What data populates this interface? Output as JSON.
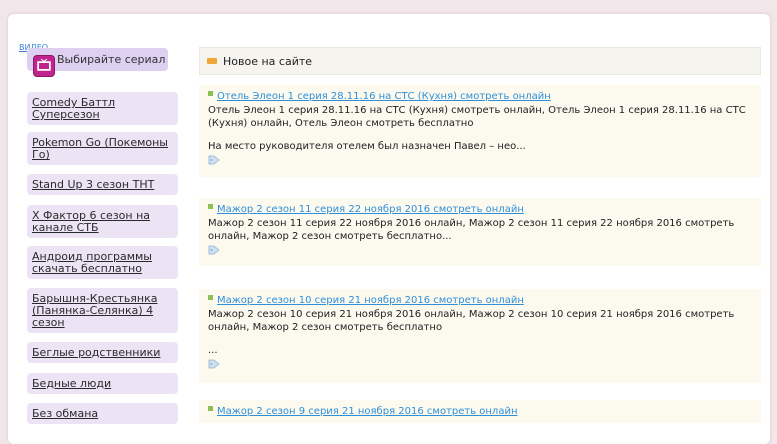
{
  "top_link": "ВИДЕО",
  "sidebar": {
    "header": "Выбирайте сериал",
    "items": [
      {
        "label": "Comedy Баттл Суперсезон"
      },
      {
        "label": "Pokemon Go (Покемоны Го)"
      },
      {
        "label": "Stand Up 3 сезон ТНТ"
      },
      {
        "label": "Х Фактор 6 сезон на канале СТБ"
      },
      {
        "label": "Андроид программы скачать бесплатно"
      },
      {
        "label": "Барышня-Крестьянка (Панянка-Селянка) 4 сезон"
      },
      {
        "label": "Беглые родственники"
      },
      {
        "label": "Бедные люди"
      },
      {
        "label": "Без обмана"
      }
    ]
  },
  "main": {
    "header": "Новое на сайте",
    "posts": [
      {
        "title": "Отель Элеон 1 серия 28.11.16 на СТС (Кухня) смотреть онлайн",
        "desc": "Отель Элеон 1 серия 28.11.16 на СТС (Кухня) смотреть онлайн, Отель Элеон 1 серия 28.11.16 на СТС (Кухня) онлайн, Отель Элеон смотреть бесплатно",
        "extra": "На место руководителя отелем был назначен Павел – нео..."
      },
      {
        "title": "Мажор 2 сезон 11 серия 22 ноября 2016 смотреть онлайн",
        "desc": "Мажор 2 сезон 11 серия 22 ноября 2016 онлайн, Мажор 2 сезон 11 серия 22 ноября 2016 смотреть онлайн, Мажор 2 сезон смотреть бесплатно...",
        "extra": ""
      },
      {
        "title": "Мажор 2 сезон 10 серия 21 ноября 2016 смотреть онлайн",
        "desc": "Мажор 2 сезон 10 серия 21 ноября 2016 онлайн, Мажор 2 сезон 10 серия 21 ноября 2016 смотреть онлайн, Мажор 2 сезон смотреть бесплатно",
        "extra": "..."
      },
      {
        "title": "Мажор 2 сезон 9 серия 21 ноября 2016 смотреть онлайн",
        "desc": "",
        "extra": ""
      }
    ]
  }
}
